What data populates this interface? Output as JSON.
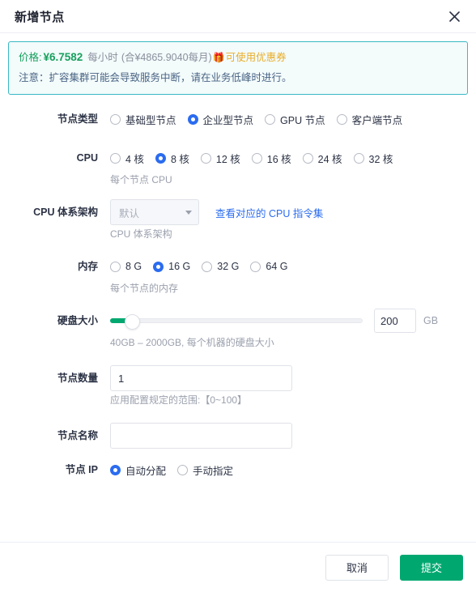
{
  "dialog": {
    "title": "新增节点",
    "close_icon": "close-icon"
  },
  "notice": {
    "price_label": "价格:",
    "price_amount": "¥6.7582",
    "price_unit": "每小时",
    "price_month": "(合¥4865.9040每月)",
    "gift_icon": "🎁",
    "coupon_text": "可使用优惠券",
    "warning": "注意：扩容集群可能会导致服务中断，请在业务低峰时进行。"
  },
  "form": {
    "node_type": {
      "label": "节点类型",
      "options": [
        {
          "label": "基础型节点",
          "checked": false
        },
        {
          "label": "企业型节点",
          "checked": true
        },
        {
          "label": "GPU 节点",
          "checked": false
        },
        {
          "label": "客户端节点",
          "checked": false
        }
      ]
    },
    "cpu": {
      "label": "CPU",
      "options": [
        {
          "label": "4 核",
          "checked": false
        },
        {
          "label": "8 核",
          "checked": true
        },
        {
          "label": "12 核",
          "checked": false
        },
        {
          "label": "16 核",
          "checked": false
        },
        {
          "label": "24 核",
          "checked": false
        },
        {
          "label": "32 核",
          "checked": false
        }
      ],
      "hint": "每个节点 CPU"
    },
    "cpu_arch": {
      "label": "CPU 体系架构",
      "value": "默认",
      "link": "查看对应的 CPU 指令集",
      "hint": "CPU 体系架构"
    },
    "memory": {
      "label": "内存",
      "options": [
        {
          "label": "8 G",
          "checked": false
        },
        {
          "label": "16 G",
          "checked": true
        },
        {
          "label": "32 G",
          "checked": false
        },
        {
          "label": "64 G",
          "checked": false
        }
      ],
      "hint": "每个节点的内存"
    },
    "disk": {
      "label": "硬盘大小",
      "value": "200",
      "unit": "GB",
      "min": 40,
      "max": 2000,
      "hint": "40GB – 2000GB, 每个机器的硬盘大小"
    },
    "node_count": {
      "label": "节点数量",
      "value": "1",
      "placeholder": "",
      "hint": "应用配置规定的范围:【0~100】"
    },
    "node_name": {
      "label": "节点名称",
      "value": "",
      "placeholder": ""
    },
    "node_ip": {
      "label": "节点 IP",
      "options": [
        {
          "label": "自动分配",
          "checked": true
        },
        {
          "label": "手动指定",
          "checked": false
        }
      ]
    }
  },
  "footer": {
    "cancel_label": "取消",
    "submit_label": "提交"
  },
  "colors": {
    "primary_green": "#00a870",
    "radio_blue": "#2b6cf0",
    "link_blue": "#2b6cf0",
    "notice_border": "#39b8c4",
    "notice_bg": "#f3fbfb",
    "coupon_orange": "#e9ad2a"
  }
}
